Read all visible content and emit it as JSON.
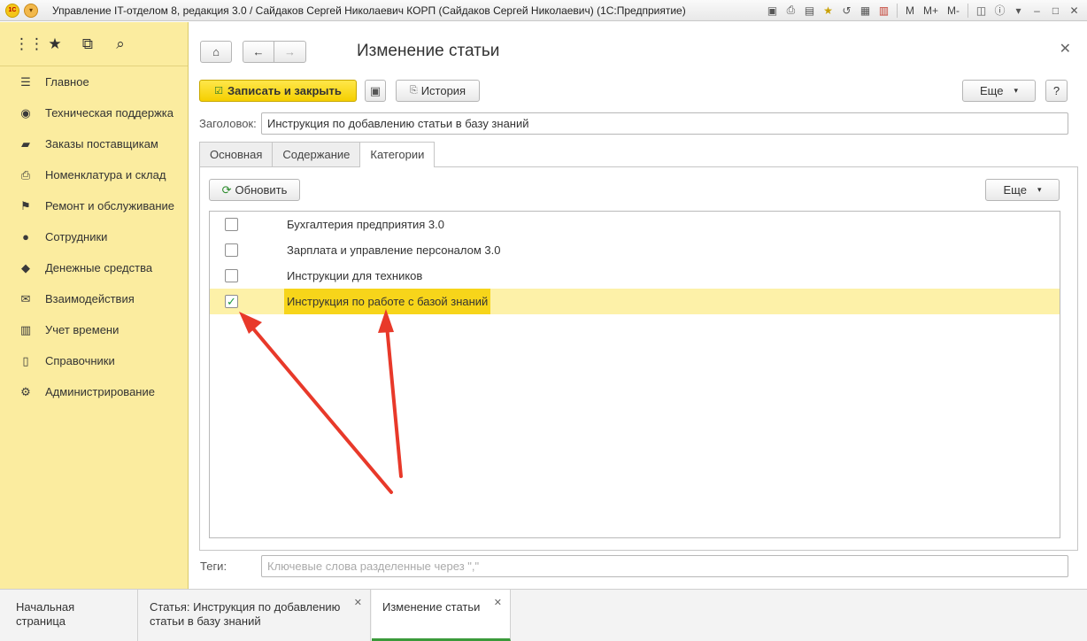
{
  "window": {
    "title": "Управление IT-отделом 8, редакция 3.0 / Сайдаков Сергей Николаевич КОРП (Сайдаков Сергей Николаевич)  (1С:Предприятие)",
    "logo_text": "1С",
    "toolbar_m": "M",
    "toolbar_mplus": "M+",
    "toolbar_mminus": "M-"
  },
  "sidebar": {
    "items": [
      {
        "label": "Главное",
        "icon": "menu-lines-icon"
      },
      {
        "label": "Техническая поддержка",
        "icon": "support-icon"
      },
      {
        "label": "Заказы поставщикам",
        "icon": "truck-icon"
      },
      {
        "label": "Номенклатура и склад",
        "icon": "printer-icon"
      },
      {
        "label": "Ремонт и обслуживание",
        "icon": "repair-flag-icon"
      },
      {
        "label": "Сотрудники",
        "icon": "people-icon"
      },
      {
        "label": "Денежные средства",
        "icon": "money-bag-icon"
      },
      {
        "label": "Взаимодействия",
        "icon": "envelope-icon"
      },
      {
        "label": "Учет времени",
        "icon": "calendar-icon"
      },
      {
        "label": "Справочники",
        "icon": "books-icon"
      },
      {
        "label": "Администрирование",
        "icon": "gear-icon"
      }
    ]
  },
  "form": {
    "title": "Изменение статьи",
    "save_close_label": "Записать и закрыть",
    "history_label": "История",
    "more_label": "Еще",
    "help_label": "?",
    "heading_label": "Заголовок:",
    "heading_value": "Инструкция по добавлению статьи в базу знаний",
    "tabs": [
      {
        "label": "Основная"
      },
      {
        "label": "Содержание"
      },
      {
        "label": "Категории"
      }
    ],
    "refresh_label": "Обновить",
    "list_more_label": "Еще",
    "categories": [
      {
        "label": "Бухгалтерия предприятия 3.0",
        "checked": false
      },
      {
        "label": "Зарплата и управление персоналом 3.0",
        "checked": false
      },
      {
        "label": "Инструкции для техников",
        "checked": false
      },
      {
        "label": "Инструкция по работе с базой знаний",
        "checked": true
      }
    ],
    "check_mark": "✓",
    "tags_label": "Теги:",
    "tags_placeholder": "Ключевые слова разделенные через \",\""
  },
  "bottom_tabs": [
    {
      "label": "Начальная страница"
    },
    {
      "label": "Статья: Инструкция по добавлению статьи в базу знаний"
    },
    {
      "label": "Изменение статьи"
    }
  ],
  "colors": {
    "sidebar_bg": "#fbec9f",
    "selected_row": "#fdf1a8",
    "accent_yellow": "#f5cf00",
    "annotation_arrow": "#e8392a",
    "active_tab_underline": "#3a9a3a"
  }
}
